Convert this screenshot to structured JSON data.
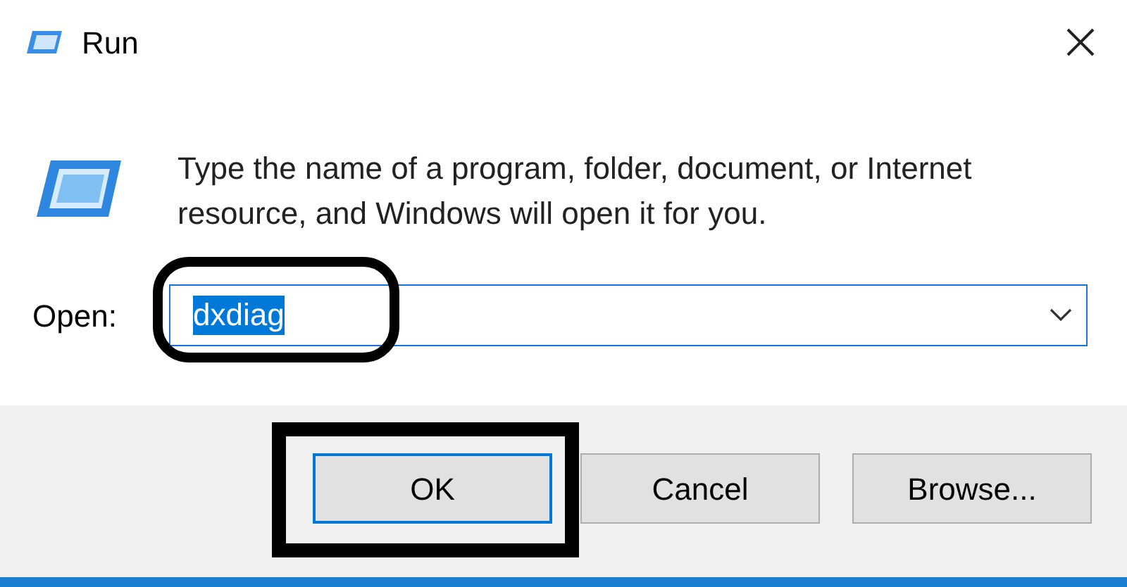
{
  "window": {
    "title": "Run"
  },
  "description": "Type the name of a program, folder, document, or Internet resource, and Windows will open it for you.",
  "open_field": {
    "label": "Open:",
    "value": "dxdiag",
    "text_selected": true
  },
  "buttons": [
    {
      "label": "OK",
      "default": true
    },
    {
      "label": "Cancel",
      "default": false
    },
    {
      "label": "Browse...",
      "default": false
    }
  ]
}
